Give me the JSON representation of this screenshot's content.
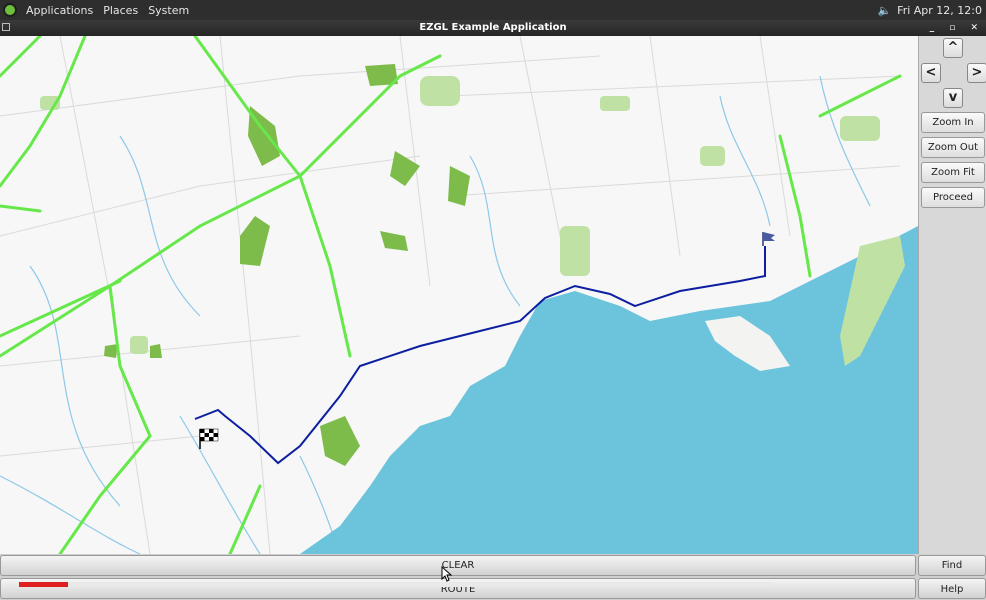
{
  "topbar": {
    "menus": [
      "Applications",
      "Places",
      "System"
    ],
    "clock": "Fri Apr 12, 12:0"
  },
  "window": {
    "title": "EZGL Example Application"
  },
  "side": {
    "arrows": {
      "up": "^",
      "left": "<",
      "right": ">",
      "down": "v"
    },
    "buttons": [
      "Zoom In",
      "Zoom Out",
      "Zoom Fit",
      "Proceed"
    ]
  },
  "bottom": {
    "clear_label": "CLEAR",
    "route_label": "ROUTE",
    "find_label": "Find",
    "help_label": "Help",
    "progress": 0.065
  },
  "colors": {
    "water": "#6cc4dc",
    "park": "#7dbb4a",
    "highway": "#66e84a",
    "stream": "#8ec9e8",
    "route": "#0d1fa0",
    "progress_fill": "#e02020"
  },
  "icons": [
    "volume-icon",
    "network-icon",
    "checkered-flag-icon",
    "destination-flag-icon"
  ]
}
